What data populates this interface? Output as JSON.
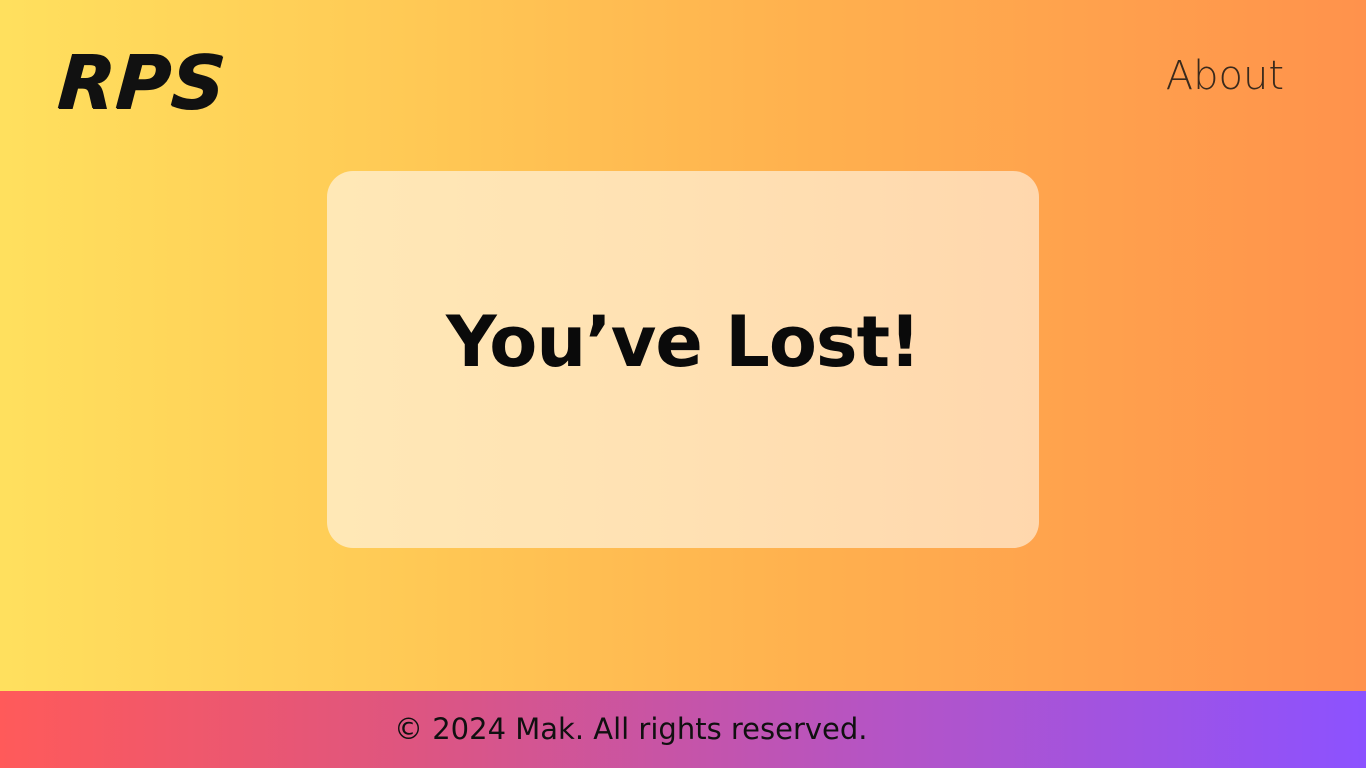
{
  "header": {
    "logo_text": "RPS",
    "nav": {
      "about_label": "About"
    }
  },
  "main": {
    "result_message": "You’ve Lost!"
  },
  "footer": {
    "copyright": "© 2024 Mak. All rights reserved."
  },
  "colors": {
    "background_gradient_start": "#ffe05e",
    "background_gradient_end": "#ff924c",
    "card_background": "#ffe4b3",
    "footer_gradient_start": "#ff5a5a",
    "footer_gradient_end": "#8c52ff",
    "text_dark": "#0a0a0a"
  }
}
